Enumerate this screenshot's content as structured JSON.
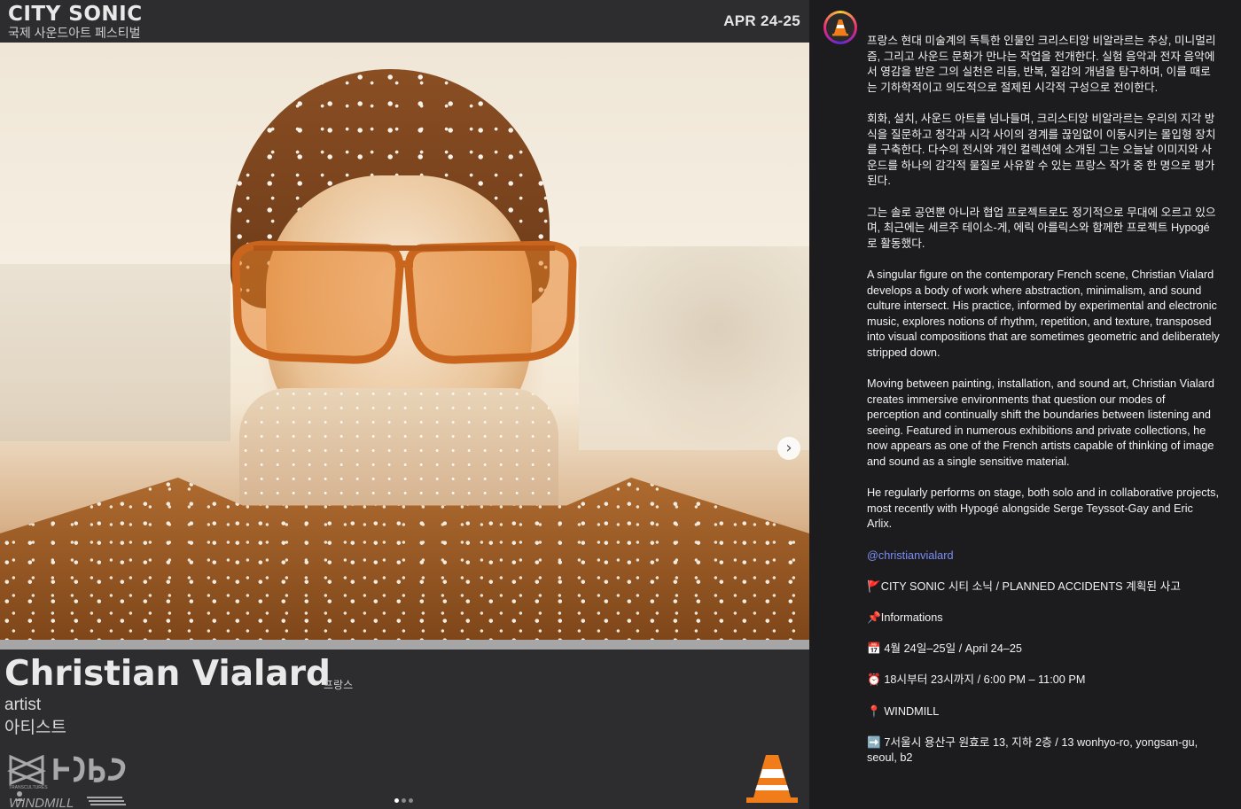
{
  "post": {
    "brand": "CITY SONIC",
    "brand_sub": "국제 사운드아트 페스티벌",
    "dates": "APR 24-25",
    "artist_name": "Christian Vialard",
    "country": "프랑스",
    "role_en": "artist",
    "role_ko": "아티스트",
    "logo_small_text": "TRANSCULTURES",
    "logo_venue_text": "WINDMILL",
    "carousel_pages": 3,
    "carousel_active": 0,
    "next_icon": "chevron-right-icon"
  },
  "caption": {
    "ko_p1": "프랑스 현대 미술계의 독특한 인물인 크리스티앙 비알라르는 추상, 미니멀리즘, 그리고 사운드 문화가 만나는 작업을 전개한다. 실험 음악과 전자 음악에서 영감을 받은 그의 실천은 리듬, 반복, 질감의 개념을 탐구하며, 이를 때로는 기하학적이고 의도적으로 절제된 시각적 구성으로 전이한다.",
    "ko_p2": "회화, 설치, 사운드 아트를 넘나들며, 크리스티앙 비알라르는 우리의 지각 방식을 질문하고 청각과 시각 사이의 경계를 끊임없이 이동시키는 몰입형 장치를 구축한다. 다수의 전시와 개인 컬렉션에 소개된 그는 오늘날 이미지와 사운드를 하나의 감각적 물질로 사유할 수 있는 프랑스 작가 중 한 명으로 평가된다.",
    "ko_p3": "그는 솔로 공연뿐 아니라 협업 프로젝트로도 정기적으로 무대에 오르고 있으며, 최근에는 세르주 테이소-게, 에릭 아를릭스와 함께한 프로젝트 Hypogé로 활동했다.",
    "en_p1": "A singular figure on the contemporary French scene, Christian Vialard develops a body of work where abstraction, minimalism, and sound culture intersect. His practice, informed by experimental and electronic music, explores notions of rhythm, repetition, and texture, transposed into visual compositions that are sometimes geometric and deliberately stripped down.",
    "en_p2": "Moving between painting, installation, and sound art, Christian Vialard creates immersive environments that question our modes of perception and continually shift the boundaries between listening and seeing. Featured in numerous exhibitions and private collections, he now appears as one of the French artists capable of thinking of image and sound as a single sensitive material.",
    "en_p3": "He regularly performs on stage, both solo and in collaborative projects, most recently with Hypogé alongside Serge Teyssot-Gay and Eric Arlix.",
    "mention": "@christianvialard",
    "festival": "🚩CITY SONIC 시티 소닉 / PLANNED ACCIDENTS 계획된 사고",
    "info_heading": "📌Informations",
    "date_line": "📅 4월 24일–25일 / April 24–25",
    "time_line": "⏰ 18시부터 23시까지 / 6:00 PM – 11:00 PM",
    "venue_line": "📍 WINDMILL",
    "address_line": "➡️ 7서울시 용산구 원효로 13, 지하 2층 / 13 wonhyo-ro, yongsan-gu, seoul, b2"
  },
  "colors": {
    "caption_bg": "#1c1c1e",
    "post_bg": "#2d2d2f",
    "mention": "#7c8ef5",
    "cone_orange": "#f07d1a"
  }
}
